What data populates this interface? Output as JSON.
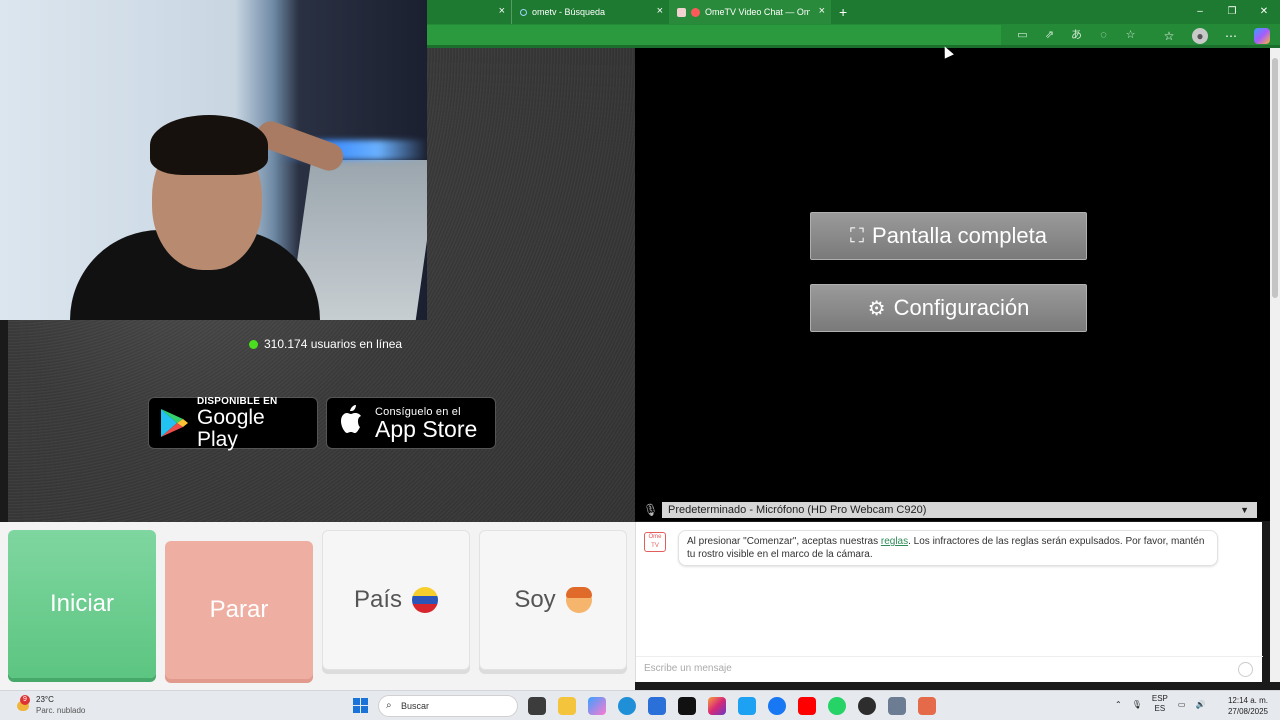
{
  "browser": {
    "tabs": [
      {
        "label": ""
      },
      {
        "label": "ometv - Búsqueda"
      },
      {
        "label": "OmeTV Video Chat — Ome..."
      }
    ],
    "new_tab": "+",
    "window_controls": [
      "–",
      "❐",
      "✕"
    ]
  },
  "stats": {
    "online": "310.174 usuarios en línea"
  },
  "stores": {
    "google": {
      "small": "DISPONIBLE EN",
      "big": "Google Play"
    },
    "apple": {
      "small": "Consíguelo en el",
      "big": "App Store"
    }
  },
  "video_controls": {
    "fullscreen": "Pantalla completa",
    "settings": "Configuración"
  },
  "mic": {
    "selected": "Predeterminado - Micrófono (HD Pro Webcam C920)"
  },
  "buttons": {
    "start": "Iniciar",
    "stop": "Parar",
    "country": "País",
    "gender": "Soy"
  },
  "chat": {
    "logo": "Ome TV",
    "message_before": "Al presionar \"Comenzar\", aceptas nuestras ",
    "message_link": "reglas",
    "message_after": ". Los infractores de las reglas serán expulsados. Por favor, mantén tu rostro visible en el marco de la cámara.",
    "placeholder": "Escribe un mensaje"
  },
  "taskbar": {
    "weather_badge": "9",
    "temp": "23°C",
    "condition": "Parc. nublado",
    "search": "Buscar",
    "lang1": "ESP",
    "lang2": "ES",
    "time": "12:14 a. m.",
    "date": "27/08/2025"
  },
  "colors": {
    "accent_green": "#1e7a31",
    "start": "#6ccc8f",
    "stop": "#eeaea2"
  }
}
